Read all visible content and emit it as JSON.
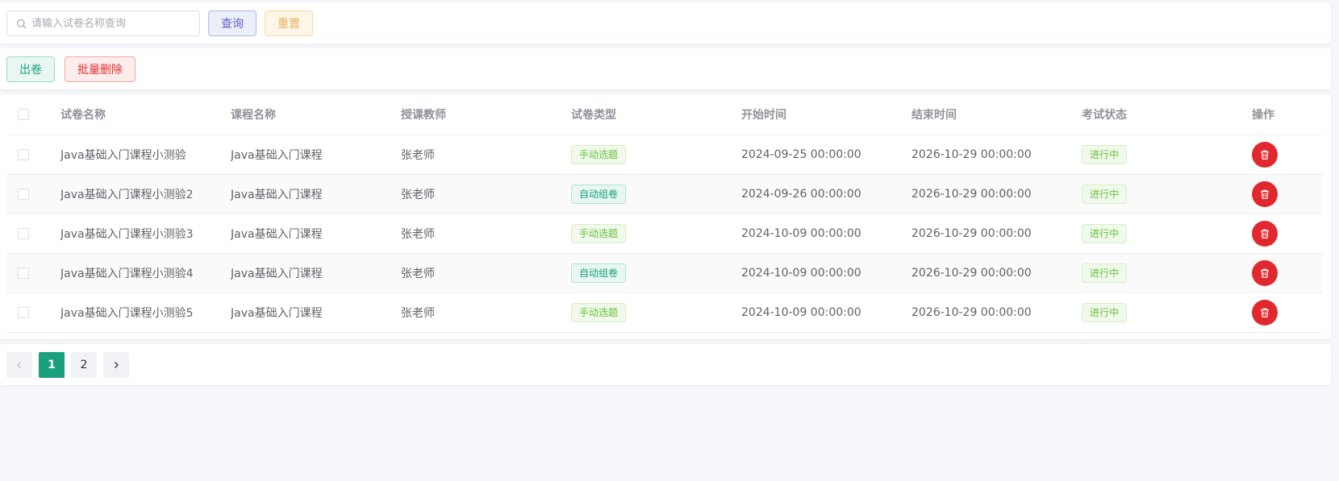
{
  "search": {
    "placeholder": "请输入试卷名称查询",
    "value": "",
    "query_label": "查询",
    "reset_label": "重置"
  },
  "actions": {
    "create_label": "出卷",
    "batch_delete_label": "批量删除"
  },
  "table": {
    "headers": [
      "试卷名称",
      "课程名称",
      "授课教师",
      "试卷类型",
      "开始时间",
      "结束时间",
      "考试状态",
      "操作"
    ],
    "rows": [
      {
        "name": "Java基础入门课程小测验",
        "course": "Java基础入门课程",
        "teacher": "张老师",
        "type": "手动选题",
        "start": "2024-09-25 00:00:00",
        "end": "2026-10-29 00:00:00",
        "status": "进行中"
      },
      {
        "name": "Java基础入门课程小测验2",
        "course": "Java基础入门课程",
        "teacher": "张老师",
        "type": "自动组卷",
        "start": "2024-09-26 00:00:00",
        "end": "2026-10-29 00:00:00",
        "status": "进行中"
      },
      {
        "name": "Java基础入门课程小测验3",
        "course": "Java基础入门课程",
        "teacher": "张老师",
        "type": "手动选题",
        "start": "2024-10-09 00:00:00",
        "end": "2026-10-29 00:00:00",
        "status": "进行中"
      },
      {
        "name": "Java基础入门课程小测验4",
        "course": "Java基础入门课程",
        "teacher": "张老师",
        "type": "自动组卷",
        "start": "2024-10-09 00:00:00",
        "end": "2026-10-29 00:00:00",
        "status": "进行中"
      },
      {
        "name": "Java基础入门课程小测验5",
        "course": "Java基础入门课程",
        "teacher": "张老师",
        "type": "手动选题",
        "start": "2024-10-09 00:00:00",
        "end": "2026-10-29 00:00:00",
        "status": "进行中"
      }
    ]
  },
  "pagination": {
    "current": 1,
    "pages": [
      "1",
      "2"
    ]
  },
  "icons": {
    "search": "search-icon",
    "delete": "trash-icon",
    "prev": "chevron-left-icon",
    "next": "chevron-right-icon"
  },
  "colors": {
    "accent": "#1aa07a",
    "danger": "#e0282e",
    "query": "#5d63c4",
    "reset": "#e6b35a",
    "tag_manual": "#67c23a"
  }
}
